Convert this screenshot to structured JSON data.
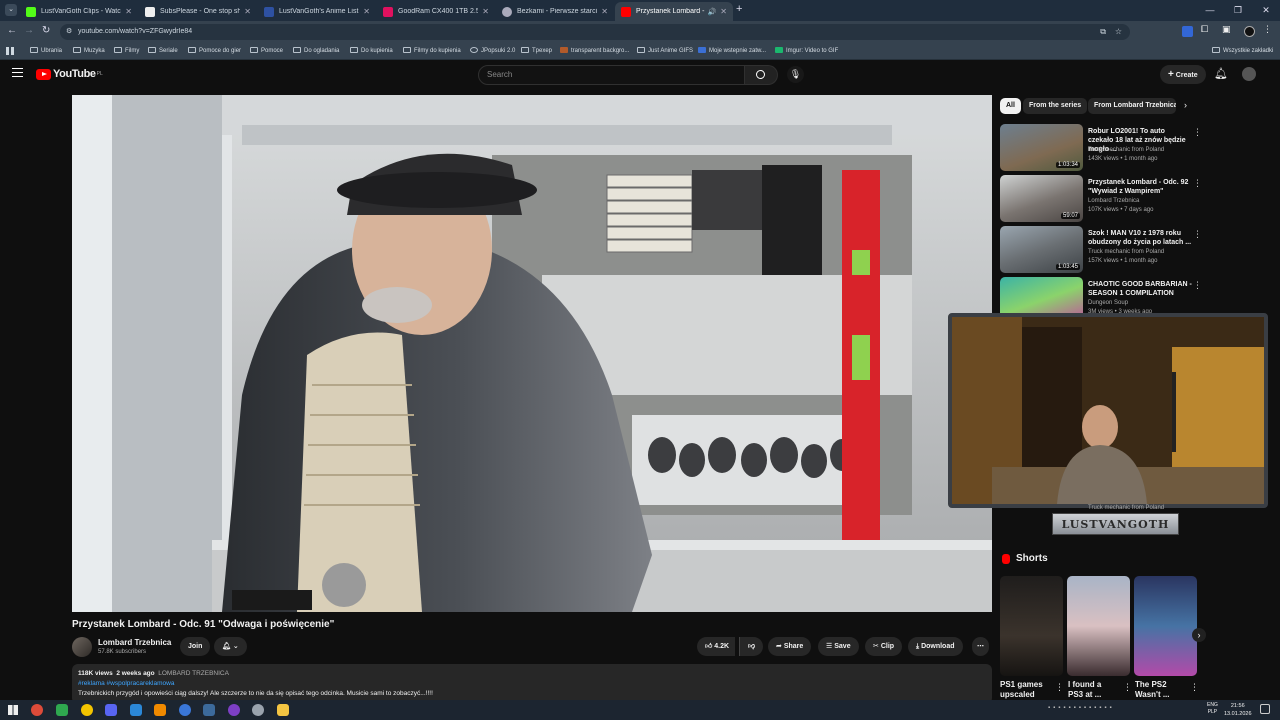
{
  "browser": {
    "tabs": [
      {
        "title": "LustVanGoth Clips - Watch Live",
        "color": "#53fc18"
      },
      {
        "title": "SubsPlease - One stop shop fo",
        "color": "#ffffff"
      },
      {
        "title": "LustVanGoth's Anime List - My",
        "color": "#2e51a2"
      },
      {
        "title": "GoodRam CX400 1TB 2.5\" SATA",
        "color": "#e0115f"
      },
      {
        "title": "Bezkami - Pierwsze starcie / Th",
        "color": "#cccccc"
      },
      {
        "title": "Przystanek Lombard - Odc",
        "color": "#ff0000"
      }
    ],
    "url": "youtube.com/watch?v=ZFGwydrIe84",
    "bookmarks": [
      "Ubrania",
      "Muzyka",
      "Filmy",
      "Seriale",
      "Pomoce do gier",
      "Pomoce",
      "Do ogladania",
      "Do kupienia",
      "Filmy do kupienia",
      "JPopsuki 2.0",
      "Tpexep",
      "transparent backgro...",
      "Just Anime GIFS",
      "Moje wstepnie zatw...",
      "Imgur: Video to GIF"
    ],
    "all_bookmarks": "Wszystkie zakładki"
  },
  "youtube": {
    "logo_text": "YouTube",
    "logo_suffix": "PL",
    "search_placeholder": "Search",
    "create_label": "Create"
  },
  "video": {
    "title": "Przystanek Lombard - Odc. 91 \"Odwaga i poświęcenie\"",
    "channel": "Lombard Trzebnica",
    "subscribers": "57.8K subscribers",
    "join_label": "Join",
    "likes": "4.2K",
    "share_label": "Share",
    "save_label": "Save",
    "clip_label": "Clip",
    "download_label": "Download",
    "views": "118K views",
    "age": "2 weeks ago",
    "channel_caps": "LOMBARD TRZEBNICA",
    "hashtags": "#reklama #wspolpracareklamowa",
    "description": "Trzebnickich przygód i opowieści ciąg dalszy! Ale szczerze to nie da się opisać tego odcinka. Musicie sami to zobaczyć...!!!!"
  },
  "chips": [
    "All",
    "From the series",
    "From Lombard Trzebnica"
  ],
  "recommendations": [
    {
      "title": "Robur LO2001! To auto czekało 18 lat aż znów będzie mogło ...",
      "channel": "Truck mechanic from Poland",
      "meta": "143K views • 1 month ago",
      "duration": "1:03:34"
    },
    {
      "title": "Przystanek Lombard - Odc. 92 \"Wywiad z Wampirem\"",
      "channel": "Lombard Trzebnica",
      "meta": "107K views • 7 days ago",
      "duration": "59:07"
    },
    {
      "title": "Szok ! MAN V10 z 1978 roku obudzony do życia po latach ...",
      "channel": "Truck mechanic from Poland",
      "meta": "157K views • 1 month ago",
      "duration": "1:03:45"
    },
    {
      "title": "CHAOTIC GOOD BARBARIAN - SEASON 1 COMPILATION",
      "channel": "Dungeon Soup",
      "meta": "3M views • 3 weeks ago",
      "duration": ""
    }
  ],
  "overlay": {
    "channel_peek": "Truck mechanic from Poland",
    "banner": "LUSTVANGOTH"
  },
  "shorts": {
    "heading": "Shorts",
    "items": [
      {
        "title": "PS1 games upscaled to..."
      },
      {
        "title": "I found a PS3 at ..."
      },
      {
        "title": "The PS2 Wasn't ..."
      }
    ]
  },
  "taskbar": {
    "lang_top": "ENG",
    "lang_bottom": "PLP",
    "time": "21:56",
    "date": "13.01.2026"
  }
}
